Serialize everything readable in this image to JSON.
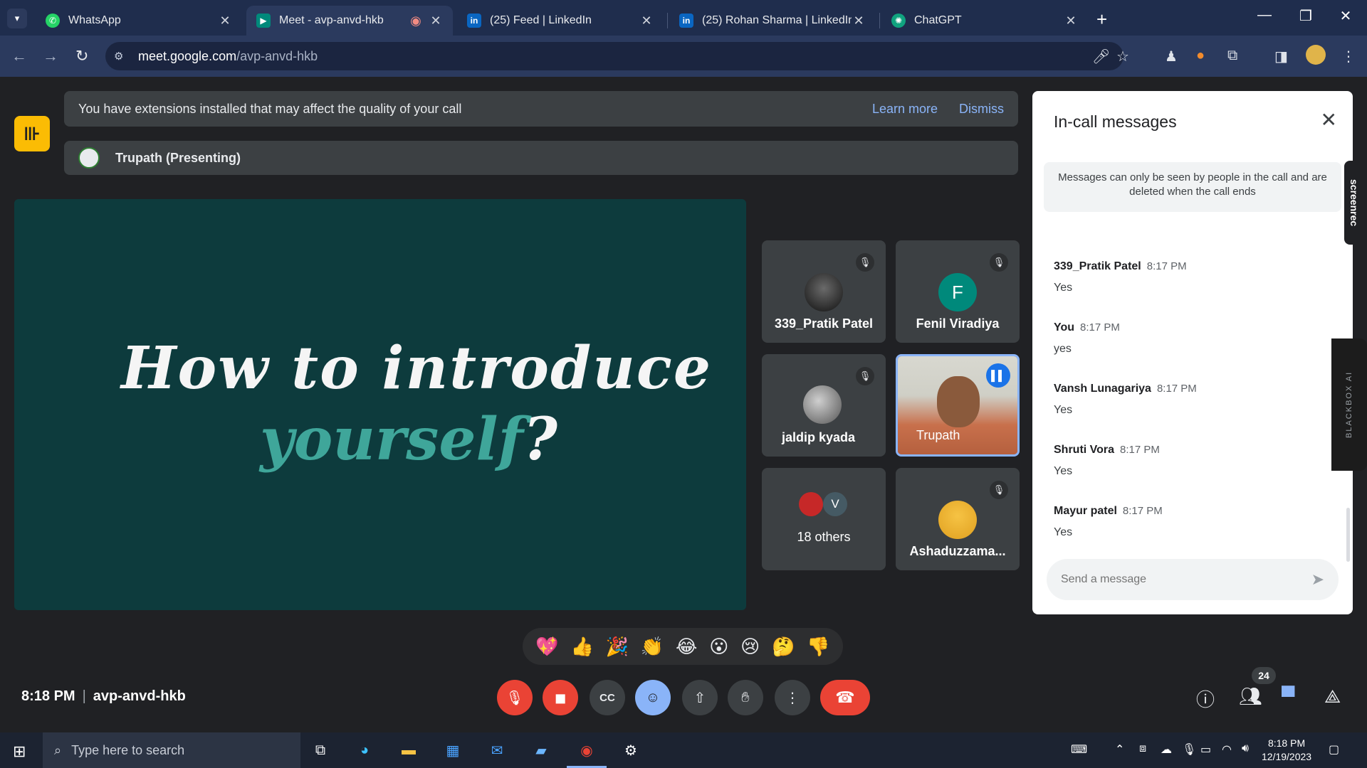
{
  "browser": {
    "tabs": [
      {
        "title": "WhatsApp",
        "favicon": "whatsapp-icon",
        "color": "#25d366"
      },
      {
        "title": "Meet - avp-anvd-hkb",
        "favicon": "google-meet-icon",
        "color": "#00897b",
        "active": true
      },
      {
        "title": "(25) Feed | LinkedIn",
        "favicon": "linkedin-icon",
        "color": "#0a66c2"
      },
      {
        "title": "(25) Rohan Sharma | LinkedIn",
        "favicon": "linkedin-icon",
        "color": "#0a66c2"
      },
      {
        "title": "ChatGPT",
        "favicon": "chatgpt-icon",
        "color": "#10a37f"
      }
    ],
    "url_host": "meet.google.com",
    "url_path": "/avp-anvd-hkb"
  },
  "meet": {
    "notice": {
      "message": "You have extensions installed that may affect the quality of your call",
      "learn_more": "Learn more",
      "dismiss": "Dismiss"
    },
    "presenting_label": "Trupath (Presenting)",
    "slide": {
      "line1": "How to introduce",
      "line2": "yourself",
      "mark": "?"
    },
    "tiles": [
      {
        "name": "339_Pratik Patel",
        "muted": true
      },
      {
        "name": "Fenil Viradiya",
        "initial": "F",
        "muted": true
      },
      {
        "name": "jaldip kyada",
        "muted": true
      },
      {
        "name": "Trupath",
        "speaking": true
      },
      {
        "name": "18 others",
        "initial": "V"
      },
      {
        "name": "Ashaduzzama...",
        "muted": true
      }
    ],
    "reactions": [
      "💖",
      "👍",
      "🎉",
      "👏",
      "😂",
      "😮",
      "😢",
      "🤔",
      "👎"
    ],
    "time": "8:18 PM",
    "meeting_code": "avp-anvd-hkb",
    "participants_count": "24"
  },
  "chat": {
    "title": "In-call messages",
    "info": "Messages can only be seen by people in the call and are deleted when the call ends",
    "messages": [
      {
        "sender": "339_Pratik Patel",
        "time": "8:17 PM",
        "text": "Yes"
      },
      {
        "sender": "You",
        "time": "8:17 PM",
        "text": "yes"
      },
      {
        "sender": "Vansh Lunagariya",
        "time": "8:17 PM",
        "text": "Yes"
      },
      {
        "sender": "Shruti Vora",
        "time": "8:17 PM",
        "text": "Yes"
      },
      {
        "sender": "Mayur patel",
        "time": "8:17 PM",
        "text": "Yes"
      }
    ],
    "input_placeholder": "Send a message"
  },
  "extensions": {
    "screenrec": "screenrec",
    "blackbox": "BLACKBOX AI"
  },
  "taskbar": {
    "search_placeholder": "Type here to search",
    "time": "8:18 PM",
    "date": "12/19/2023"
  }
}
